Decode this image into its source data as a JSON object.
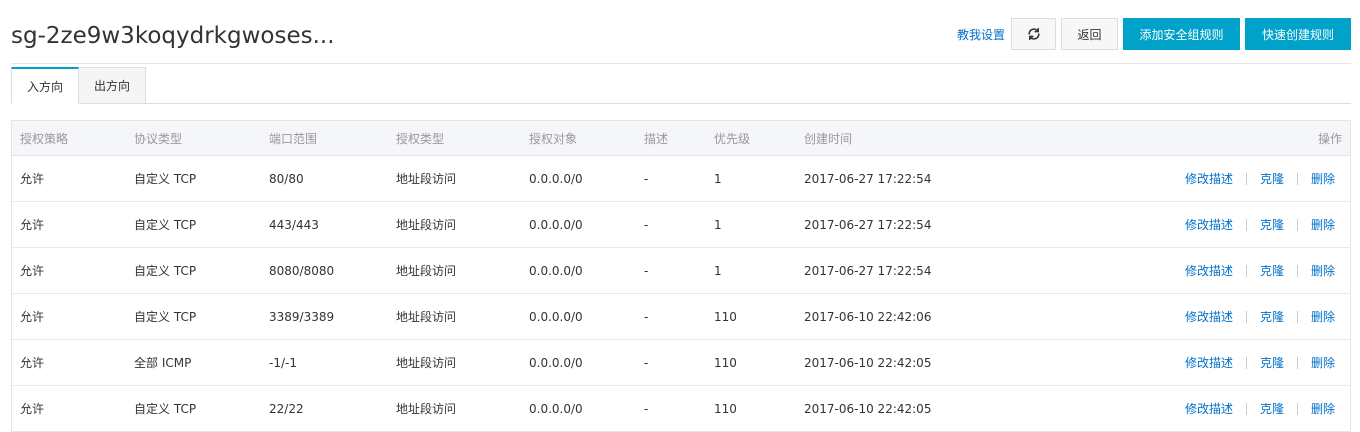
{
  "header": {
    "title": "sg-2ze9w3koqydrkgwoses...",
    "teach_link": "教我设置",
    "refresh_icon": "refresh-icon",
    "back_button": "返回",
    "add_rule_button": "添加安全组规则",
    "quick_create_button": "快速创建规则"
  },
  "tabs": [
    {
      "label": "入方向",
      "active": true
    },
    {
      "label": "出方向",
      "active": false
    }
  ],
  "table": {
    "columns": [
      "授权策略",
      "协议类型",
      "端口范围",
      "授权类型",
      "授权对象",
      "描述",
      "优先级",
      "创建时间",
      "操作"
    ],
    "actions": [
      "修改描述",
      "克隆",
      "删除"
    ],
    "rows": [
      {
        "policy": "允许",
        "protocol": "自定义 TCP",
        "ports": "80/80",
        "auth_type": "地址段访问",
        "target": "0.0.0.0/0",
        "desc": "-",
        "priority": "1",
        "created": "2017-06-27 17:22:54"
      },
      {
        "policy": "允许",
        "protocol": "自定义 TCP",
        "ports": "443/443",
        "auth_type": "地址段访问",
        "target": "0.0.0.0/0",
        "desc": "-",
        "priority": "1",
        "created": "2017-06-27 17:22:54"
      },
      {
        "policy": "允许",
        "protocol": "自定义 TCP",
        "ports": "8080/8080",
        "auth_type": "地址段访问",
        "target": "0.0.0.0/0",
        "desc": "-",
        "priority": "1",
        "created": "2017-06-27 17:22:54"
      },
      {
        "policy": "允许",
        "protocol": "自定义 TCP",
        "ports": "3389/3389",
        "auth_type": "地址段访问",
        "target": "0.0.0.0/0",
        "desc": "-",
        "priority": "110",
        "created": "2017-06-10 22:42:06"
      },
      {
        "policy": "允许",
        "protocol": "全部 ICMP",
        "ports": "-1/-1",
        "auth_type": "地址段访问",
        "target": "0.0.0.0/0",
        "desc": "-",
        "priority": "110",
        "created": "2017-06-10 22:42:05"
      },
      {
        "policy": "允许",
        "protocol": "自定义 TCP",
        "ports": "22/22",
        "auth_type": "地址段访问",
        "target": "0.0.0.0/0",
        "desc": "-",
        "priority": "110",
        "created": "2017-06-10 22:42:05"
      }
    ]
  },
  "colors": {
    "primary": "#00a2ca",
    "link": "#0070cc",
    "header_bg": "#f5f6fa"
  }
}
